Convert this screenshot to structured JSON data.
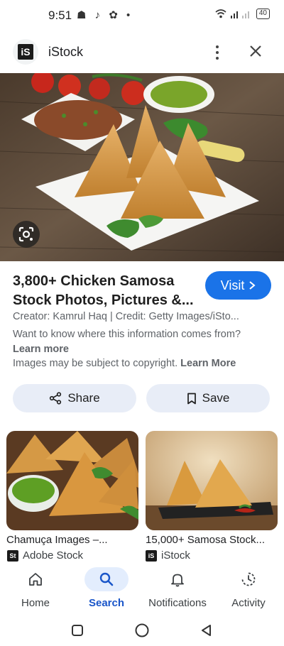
{
  "status_bar": {
    "time": "9:51",
    "notif_icons": "☗ ♪ ✿ •",
    "battery": "40"
  },
  "app": {
    "title": "iStock",
    "logo_text": "iS"
  },
  "result": {
    "title": "3,800+ Chicken Samosa Stock Photos, Pictures &...",
    "visit_label": "Visit",
    "creator": "Creator: Kamrul Haq | Credit: Getty Images/iSto...",
    "info_question": "Want to know where this information comes from?",
    "learn_more": "Learn more",
    "copyright_text": "Images may be subject to copyright.",
    "copyright_link": "Learn More"
  },
  "actions": {
    "share_label": "Share",
    "save_label": "Save"
  },
  "related": [
    {
      "title": "Chamuça Images –...",
      "source": "Adobe Stock",
      "source_logo": "St"
    },
    {
      "title": "15,000+ Samosa Stock...",
      "source": "iStock",
      "source_logo": "iS"
    }
  ],
  "bottom_nav": [
    {
      "label": "Home",
      "icon": "home-icon",
      "active": false
    },
    {
      "label": "Search",
      "icon": "search-icon",
      "active": true
    },
    {
      "label": "Notifications",
      "icon": "bell-icon",
      "active": false
    },
    {
      "label": "Activity",
      "icon": "activity-icon",
      "active": false
    }
  ],
  "colors": {
    "accent": "#1a73e8",
    "pill_bg": "#e8edf7",
    "active_nav": "#1a56c9"
  }
}
